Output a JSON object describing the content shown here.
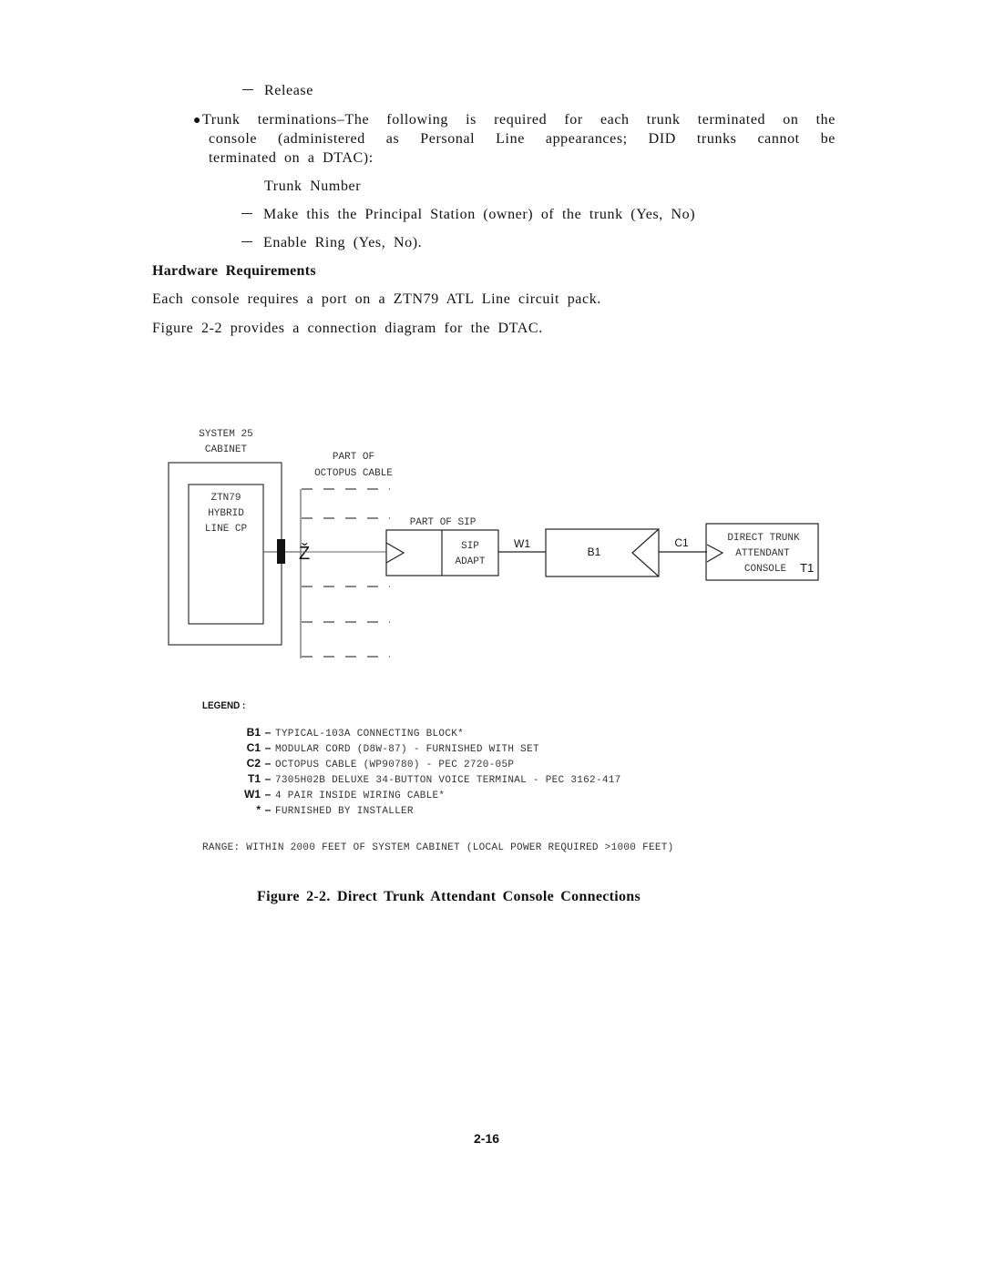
{
  "body_text": {
    "release_item": "Release",
    "trunk_terminations": {
      "line1": "Trunk terminations–The following is required for each trunk terminated on the",
      "line2": "console (administered as Personal Line appearances; DID trunks cannot be",
      "line3": "terminated on a DTAC):"
    },
    "trunk_number": "Trunk Number",
    "principal_station_item": "Make this the Principal Station (owner) of the trunk (Yes, No)",
    "enable_ring_item": "Enable Ring (Yes, No).",
    "hardware_heading": "Hardware Requirements",
    "hardware_para": "Each console requires a port on a ZTN79 ATL Line circuit pack.",
    "figure_ref_para": "Figure 2-2 provides a connection diagram for the DTAC."
  },
  "diagram": {
    "cabinet_label_line1": "SYSTEM 25",
    "cabinet_label_line2": "CABINET",
    "circuit_pack_line1": "ZTN79",
    "circuit_pack_line2": "HYBRID",
    "circuit_pack_line3": "LINE CP",
    "octopus_label_line1": "PART OF",
    "octopus_label_line2": "OCTOPUS CABLE",
    "connector_symbol": "Ž",
    "sip_label": "PART OF SIP",
    "sip_adapt_line1": "SIP",
    "sip_adapt_line2": "ADAPT",
    "w1_label": "W1",
    "b1_label": "B1",
    "c1_label": "C1",
    "console_line1": "DIRECT TRUNK",
    "console_line2": "ATTENDANT",
    "console_line3": "CONSOLE",
    "t1_label": "T1"
  },
  "legend": {
    "title": "LEGEND :",
    "items": [
      {
        "key": "B1",
        "sep": "–",
        "text": "TYPICAL-103A  CONNECTING  BLOCK*"
      },
      {
        "key": "C1",
        "sep": "–",
        "text": "MODULAR CORD (D8W-87) - FURNISHED WITH SET"
      },
      {
        "key": "C2",
        "sep": "–",
        "text": "OCTOPUS CABLE (WP90780) - PEC 2720-05P"
      },
      {
        "key": "T1",
        "sep": "–",
        "text": "7305H02B DELUXE 34-BUTTON VOICE TERMINAL - PEC 3162-417"
      },
      {
        "key": "W1",
        "sep": "–",
        "text": "4 PAIR INSIDE WIRING CABLE*"
      },
      {
        "key": "*",
        "sep": "–",
        "text": "FURNISHED  BY  INSTALLER"
      }
    ],
    "range_note": "RANGE: WITHIN 2000 FEET OF SYSTEM CABINET (LOCAL POWER REQUIRED >1000 FEET)"
  },
  "figure_caption": "Figure 2-2. Direct Trunk Attendant Console Connections",
  "page_number": "2-16"
}
